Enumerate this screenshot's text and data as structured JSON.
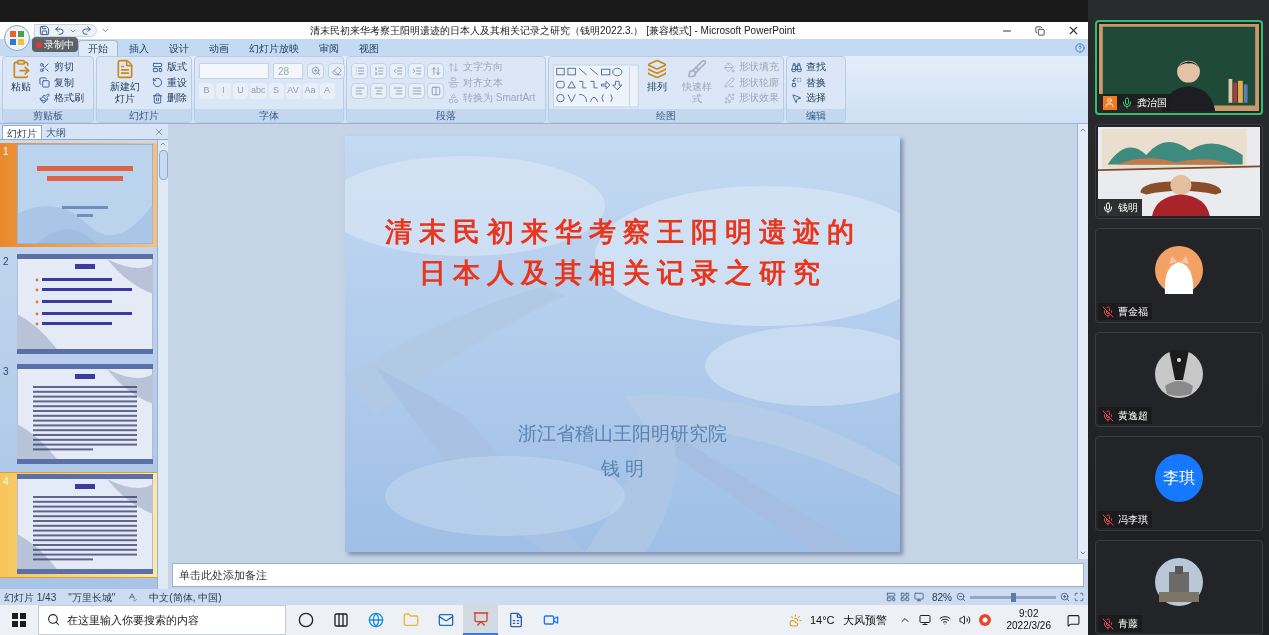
{
  "recording_badge": "录制中",
  "window": {
    "title": "清末民初来华考察王阳明遗迹的日本人及其相关记录之研究（钱明2022.3.） [兼容模式] - Microsoft PowerPoint"
  },
  "ribbon_tabs": [
    {
      "label": "开始",
      "selected": true
    },
    {
      "label": "插入",
      "selected": false
    },
    {
      "label": "设计",
      "selected": false
    },
    {
      "label": "动画",
      "selected": false
    },
    {
      "label": "幻灯片放映",
      "selected": false
    },
    {
      "label": "审阅",
      "selected": false
    },
    {
      "label": "视图",
      "selected": false
    }
  ],
  "ribbon_groups": [
    {
      "kind": "clipboard",
      "label": "剪贴板",
      "commands": [
        {
          "label": "粘贴",
          "kind": "large",
          "disabled": false
        },
        {
          "label": "剪切",
          "kind": "small",
          "disabled": false
        },
        {
          "label": "复制",
          "kind": "small",
          "disabled": false
        },
        {
          "label": "格式刷",
          "kind": "small",
          "disabled": false
        }
      ]
    },
    {
      "kind": "slides",
      "label": "幻灯片",
      "commands": [
        {
          "label": "新建幻灯片",
          "kind": "large",
          "disabled": false
        },
        {
          "label": "版式",
          "kind": "small",
          "disabled": false
        },
        {
          "label": "重设",
          "kind": "small",
          "disabled": false
        },
        {
          "label": "删除",
          "kind": "small",
          "disabled": false
        }
      ]
    },
    {
      "kind": "font",
      "label": "字体",
      "font_size": "28",
      "format_buttons": [
        "B",
        "I",
        "U",
        "abc",
        "S",
        "AV",
        "Aa",
        "A"
      ]
    },
    {
      "kind": "paragraph",
      "label": "段落",
      "commands": [
        {
          "label": "文字方向",
          "kind": "small",
          "disabled": true
        },
        {
          "label": "对齐文本",
          "kind": "small",
          "disabled": true
        },
        {
          "label": "转换为 SmartArt",
          "kind": "small",
          "disabled": true
        }
      ]
    },
    {
      "kind": "drawing",
      "label": "绘图",
      "commands": [
        {
          "label": "排列",
          "kind": "large",
          "disabled": false
        },
        {
          "label": "快速样式",
          "kind": "large",
          "disabled": true
        },
        {
          "label": "形状填充",
          "kind": "small",
          "disabled": true
        },
        {
          "label": "形状轮廓",
          "kind": "small",
          "disabled": true
        },
        {
          "label": "形状效果",
          "kind": "small",
          "disabled": true
        }
      ]
    },
    {
      "kind": "editing",
      "label": "编辑",
      "commands": [
        {
          "label": "查找",
          "kind": "small",
          "disabled": false
        },
        {
          "label": "替换",
          "kind": "small",
          "disabled": false
        },
        {
          "label": "选择",
          "kind": "small",
          "disabled": false
        }
      ]
    }
  ],
  "pane_tabs": [
    {
      "label": "幻灯片",
      "selected": true
    },
    {
      "label": "大纲",
      "selected": false
    }
  ],
  "slides": [
    {
      "number": "1",
      "kind": "title",
      "selected": true,
      "hovered": false
    },
    {
      "number": "2",
      "kind": "list",
      "selected": false,
      "hovered": false
    },
    {
      "number": "3",
      "kind": "text",
      "selected": false,
      "hovered": false
    },
    {
      "number": "4",
      "kind": "text",
      "selected": false,
      "hovered": true
    }
  ],
  "current_slide": {
    "title_lines": [
      "清末民初来华考察王阳明遗迹的",
      "日本人及其相关记录之研究"
    ],
    "subtitle": "浙江省稽山王阳明研究院",
    "author": "钱 明"
  },
  "notes": {
    "placeholder": "单击此处添加备注"
  },
  "status_bar": {
    "slide_counter": "幻灯片 1/43",
    "theme": "\"万里长城\"",
    "language": "中文(简体, 中国)",
    "zoom": "82%",
    "level": 0.5
  },
  "taskbar": {
    "search": {
      "placeholder": "在这里输入你要搜索的内容"
    },
    "apps": [
      {
        "kind": "cortana",
        "active": false
      },
      {
        "kind": "taskview",
        "active": false
      },
      {
        "kind": "browser",
        "active": false
      },
      {
        "kind": "folder",
        "active": false
      },
      {
        "kind": "mail",
        "active": false
      },
      {
        "kind": "presentation",
        "active": true
      },
      {
        "kind": "document",
        "active": false
      },
      {
        "kind": "meeting",
        "active": false
      }
    ],
    "temperature": "14°C",
    "weather_alert": "大风预警",
    "time": "9:02",
    "date": "2022/3/26"
  },
  "participants": [
    {
      "name": "龚治国",
      "kind": "video",
      "muted": false,
      "speaking": true,
      "host": true
    },
    {
      "name": "钱明",
      "kind": "video",
      "muted": false,
      "speaking": false,
      "host": false
    },
    {
      "name": "曹金福",
      "kind": "avatar",
      "muted": true,
      "speaking": false,
      "host": false
    },
    {
      "name": "黄逸超",
      "kind": "avatar",
      "muted": true,
      "speaking": false,
      "host": false
    },
    {
      "name": "冯李琪",
      "kind": "initials",
      "initials": "李琪",
      "muted": true,
      "speaking": false,
      "host": false
    },
    {
      "name": "青藤",
      "kind": "avatar",
      "muted": true,
      "speaking": false,
      "host": false
    }
  ]
}
